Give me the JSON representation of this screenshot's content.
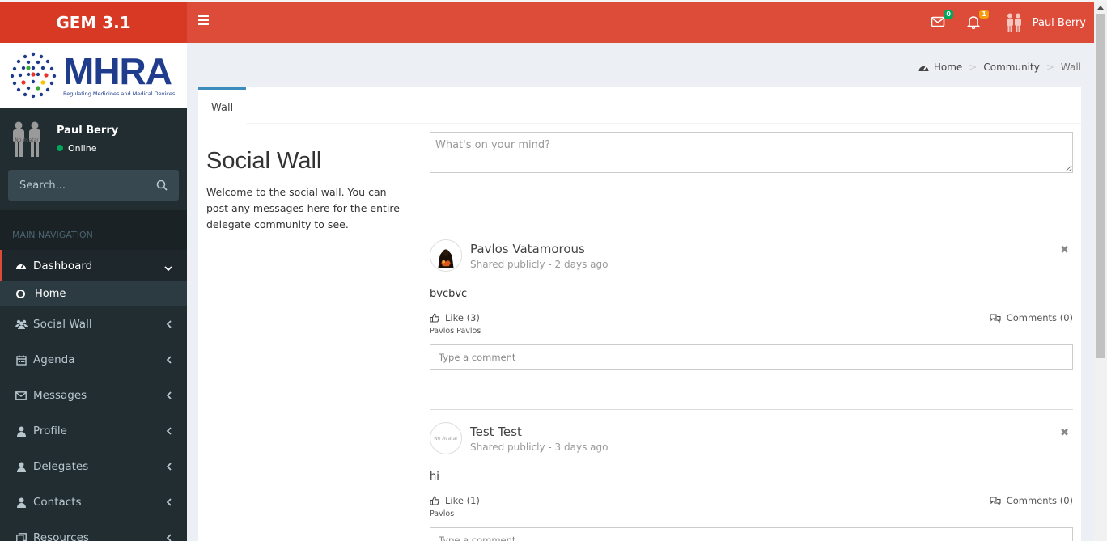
{
  "app": {
    "title": "GEM 3.1"
  },
  "brand": {
    "name": "MHRA",
    "tagline": "Regulating Medicines and Medical Devices"
  },
  "topbar": {
    "mail_badge": "0",
    "notif_badge": "1",
    "user_name": "Paul Berry",
    "colors": {
      "header": "#dd4b39",
      "logo": "#d73925"
    }
  },
  "sidebar": {
    "user": {
      "name": "Paul Berry",
      "status": "Online",
      "avatar_text": "No Avatar"
    },
    "search_placeholder": "Search...",
    "nav_header": "MAIN NAVIGATION",
    "items": [
      {
        "label": "Dashboard",
        "icon": "dashboard-icon"
      },
      {
        "label": "Social Wall",
        "icon": "users-icon"
      },
      {
        "label": "Agenda",
        "icon": "calendar-icon"
      },
      {
        "label": "Messages",
        "icon": "envelope-icon"
      },
      {
        "label": "Profile",
        "icon": "user-icon"
      },
      {
        "label": "Delegates",
        "icon": "user-icon"
      },
      {
        "label": "Contacts",
        "icon": "user-icon"
      },
      {
        "label": "Resources",
        "icon": "files-icon"
      }
    ],
    "sub_items": [
      {
        "label": "Home"
      }
    ]
  },
  "breadcrumb": {
    "home": "Home",
    "community": "Community",
    "current": "Wall"
  },
  "tabs": [
    {
      "label": "Wall"
    }
  ],
  "intro": {
    "title": "Social Wall",
    "text": "Welcome to the social wall. You can post any messages here for the entire delegate community to see."
  },
  "composer": {
    "placeholder": "What's on your mind?"
  },
  "posts": [
    {
      "author": "Pavlos Vatamorous",
      "meta": "Shared publicly - 2 days ago",
      "body": "bvcbvc",
      "like_label": "Like (3)",
      "comments_label": "Comments (0)",
      "likers": "Pavlos Pavlos",
      "comment_placeholder": "Type a comment"
    },
    {
      "author": "Test Test",
      "meta": "Shared publicly - 3 days ago",
      "body": "hi",
      "like_label": "Like (1)",
      "comments_label": "Comments (0)",
      "likers": "Pavlos",
      "comment_placeholder": "Type a comment",
      "avatar_text": "No Avatar"
    }
  ]
}
